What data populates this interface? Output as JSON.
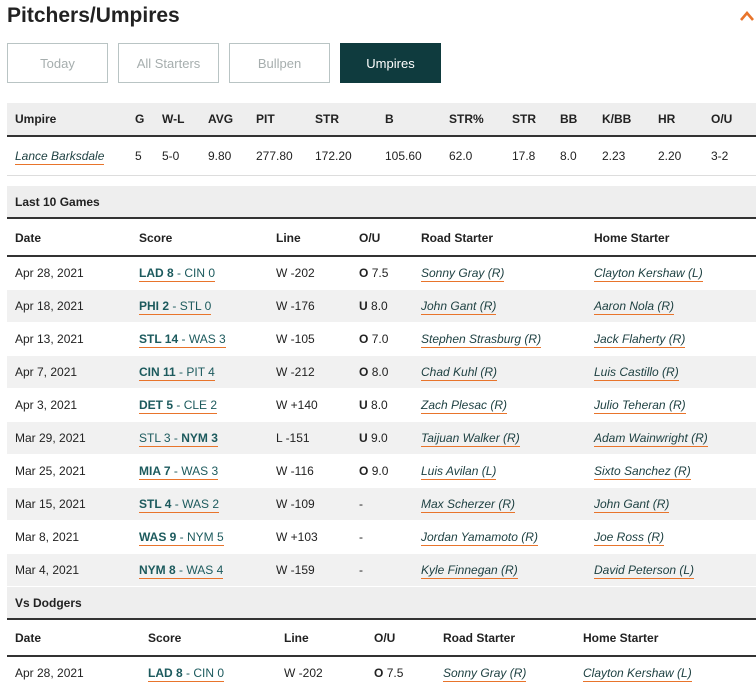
{
  "header": {
    "title": "Pitchers/Umpires"
  },
  "tabs": [
    {
      "label": "Today",
      "active": false
    },
    {
      "label": "All Starters",
      "active": false
    },
    {
      "label": "Bullpen",
      "active": false
    },
    {
      "label": "Umpires",
      "active": true
    }
  ],
  "umpire_table": {
    "columns": [
      "Umpire",
      "G",
      "W-L",
      "AVG",
      "PIT",
      "STR",
      "B",
      "STR%",
      "STR",
      "BB",
      "K/BB",
      "HR",
      "O/U"
    ],
    "row": {
      "umpire": "Lance Barksdale",
      "g": "5",
      "wl": "5-0",
      "avg": "9.80",
      "pit": "277.80",
      "str": "172.20",
      "b": "105.60",
      "strpct": "62.0",
      "str2": "17.8",
      "bb": "8.0",
      "kbb": "2.23",
      "hr": "2.20",
      "ou": "3-2"
    }
  },
  "last10": {
    "section_label": "Last 10 Games",
    "columns": [
      "Date",
      "Score",
      "Line",
      "O/U",
      "Road Starter",
      "Home Starter"
    ],
    "rows": [
      {
        "date": "Apr 28, 2021",
        "away": "LAD 8",
        "home": "CIN 0",
        "winner": "away",
        "line": "W -202",
        "ou_code": "O",
        "ou_val": "7.5",
        "road": "Sonny Gray (R)",
        "home_starter": "Clayton Kershaw (L)"
      },
      {
        "date": "Apr 18, 2021",
        "away": "PHI 2",
        "home": "STL 0",
        "winner": "away",
        "line": "W -176",
        "ou_code": "U",
        "ou_val": "8.0",
        "road": "John Gant (R)",
        "home_starter": "Aaron Nola (R)"
      },
      {
        "date": "Apr 13, 2021",
        "away": "STL 14",
        "home": "WAS 3",
        "winner": "away",
        "line": "W -105",
        "ou_code": "O",
        "ou_val": "7.0",
        "road": "Stephen Strasburg (R)",
        "home_starter": "Jack Flaherty (R)"
      },
      {
        "date": "Apr 7, 2021",
        "away": "CIN 11",
        "home": "PIT 4",
        "winner": "away",
        "line": "W -212",
        "ou_code": "O",
        "ou_val": "8.0",
        "road": "Chad Kuhl (R)",
        "home_starter": "Luis Castillo (R)"
      },
      {
        "date": "Apr 3, 2021",
        "away": "DET 5",
        "home": "CLE 2",
        "winner": "away",
        "line": "W +140",
        "ou_code": "U",
        "ou_val": "8.0",
        "road": "Zach Plesac (R)",
        "home_starter": "Julio Teheran (R)"
      },
      {
        "date": "Mar 29, 2021",
        "away": "STL 3",
        "home": "NYM 3",
        "winner": "home",
        "line": "L -151",
        "ou_code": "U",
        "ou_val": "9.0",
        "road": "Taijuan Walker (R)",
        "home_starter": "Adam Wainwright (R)"
      },
      {
        "date": "Mar 25, 2021",
        "away": "MIA 7",
        "home": "WAS 3",
        "winner": "away",
        "line": "W -116",
        "ou_code": "O",
        "ou_val": "9.0",
        "road": "Luis Avilan (L)",
        "home_starter": "Sixto Sanchez (R)"
      },
      {
        "date": "Mar 15, 2021",
        "away": "STL 4",
        "home": "WAS 2",
        "winner": "away",
        "line": "W -109",
        "ou_code": "",
        "ou_val": "-",
        "road": "Max Scherzer (R)",
        "home_starter": "John Gant (R)"
      },
      {
        "date": "Mar 8, 2021",
        "away": "WAS 9",
        "home": "NYM 5",
        "winner": "away",
        "line": "W +103",
        "ou_code": "",
        "ou_val": "-",
        "road": "Jordan Yamamoto (R)",
        "home_starter": "Joe Ross (R)"
      },
      {
        "date": "Mar 4, 2021",
        "away": "NYM 8",
        "home": "WAS 4",
        "winner": "away",
        "line": "W -159",
        "ou_code": "",
        "ou_val": "-",
        "road": "Kyle Finnegan (R)",
        "home_starter": "David Peterson (L)"
      }
    ]
  },
  "vs_dodgers": {
    "section_label": "Vs Dodgers",
    "columns": [
      "Date",
      "Score",
      "Line",
      "O/U",
      "Road Starter",
      "Home Starter"
    ],
    "rows": [
      {
        "date": "Apr 28, 2021",
        "away": "LAD 8",
        "home": "CIN 0",
        "winner": "away",
        "line": "W -202",
        "ou_code": "O",
        "ou_val": "7.5",
        "road": "Sonny Gray (R)",
        "home_starter": "Clayton Kershaw (L)"
      }
    ]
  },
  "colors": {
    "accent": "#e8742b",
    "active_tab": "#0f3b3e",
    "team_link": "#1c5a5d"
  },
  "icons": {
    "collapse": "chevron-up-icon"
  }
}
